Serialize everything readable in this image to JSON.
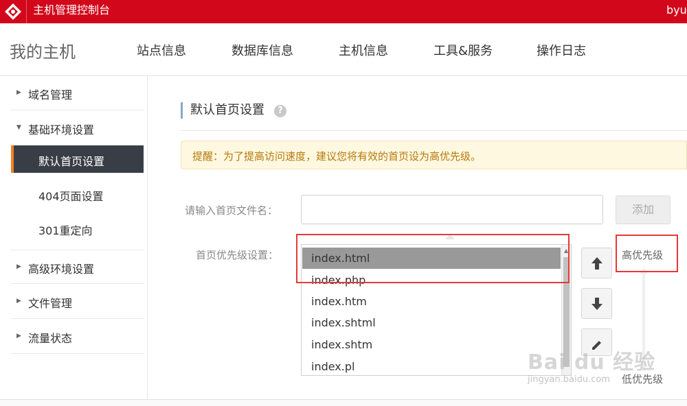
{
  "header": {
    "title": "主机管理控制台",
    "user": "byu"
  },
  "nav": {
    "brand": "我的主机",
    "items": [
      "站点信息",
      "数据库信息",
      "主机信息",
      "工具&服务",
      "操作日志"
    ]
  },
  "sidebar": {
    "groups": [
      {
        "label": "域名管理"
      },
      {
        "label": "基础环境设置"
      },
      {
        "label": "高级环境设置"
      },
      {
        "label": "文件管理"
      },
      {
        "label": "流量状态"
      }
    ],
    "sub_items": [
      "默认首页设置",
      "404页面设置",
      "301重定向"
    ]
  },
  "main": {
    "title": "默认首页设置",
    "help": "?",
    "notice": "提醒：为了提高访问速度，建议您将有效的首页设为高优先级。",
    "input_label": "请输入首页文件名：",
    "input_value": "",
    "add_button": "添加",
    "priority_label": "首页优先级设置：",
    "list": [
      "index.html",
      "index.php",
      "index.htm",
      "index.shtml",
      "index.shtm",
      "index.pl"
    ],
    "selected_index": 0,
    "high_priority": "高优先级",
    "low_priority": "低优先级"
  },
  "watermark": {
    "text": "Bai du 经验",
    "sub": "jingyan.baidu.com"
  },
  "colors": {
    "brand_red": "#d2071b",
    "active_bg": "#393e46",
    "active_accent": "#f0821e",
    "annotation": "#e53935"
  }
}
